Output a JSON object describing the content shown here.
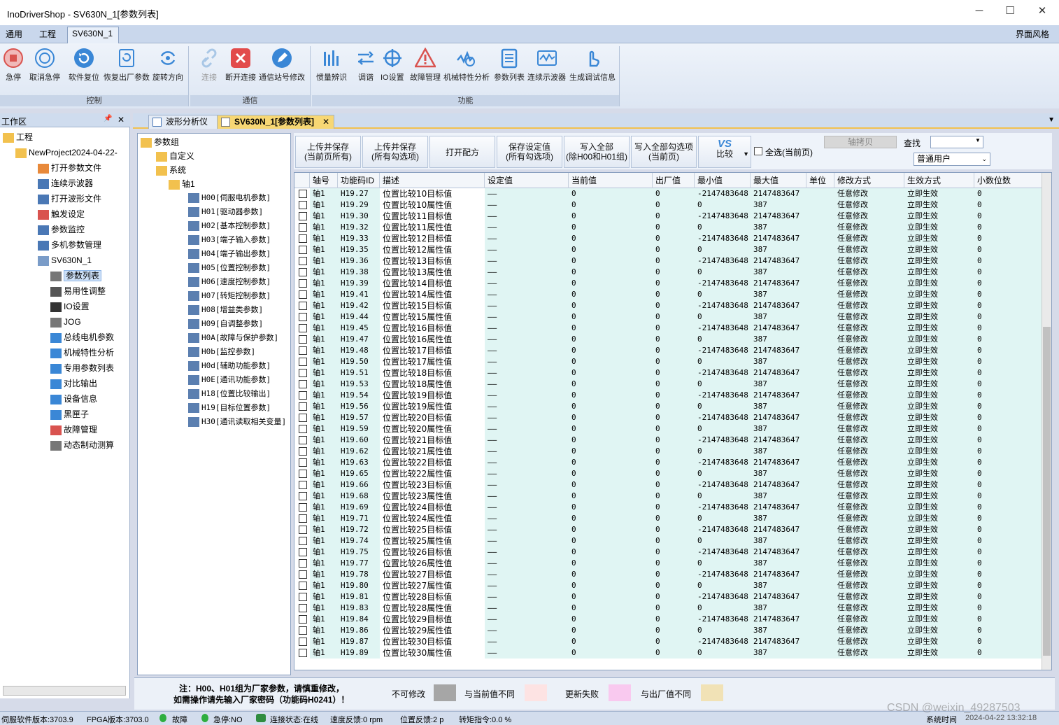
{
  "window": {
    "title": "InoDriverShop - SV630N_1[参数列表]",
    "min": "─",
    "max": "☐",
    "close": "✕"
  },
  "menu": {
    "tabs": [
      "通用",
      "工程",
      "SV630N_1"
    ],
    "style_label": "界面风格"
  },
  "ribbon": {
    "groups": [
      {
        "label": "控制",
        "buttons": [
          "急停",
          "取消急停",
          "软件复位",
          "恢复出厂参数",
          "旋转方向"
        ]
      },
      {
        "label": "通信",
        "buttons": [
          "连接",
          "断开连接",
          "通信站号修改"
        ]
      },
      {
        "label": "功能",
        "buttons": [
          "惯量辨识",
          "调谐",
          "IO设置",
          "故障管理",
          "机械特性分析",
          "参数列表",
          "连续示波器",
          "生成调试信息"
        ]
      }
    ]
  },
  "workspace": {
    "title": "工作区",
    "pin": "📌",
    "close": "✕",
    "tree": [
      {
        "label": "工程",
        "level": 0
      },
      {
        "label": "NewProject2024-04-22-",
        "level": 1
      },
      {
        "label": "打开参数文件",
        "level": 2
      },
      {
        "label": "连续示波器",
        "level": 2
      },
      {
        "label": "打开波形文件",
        "level": 2
      },
      {
        "label": "触发设定",
        "level": 2
      },
      {
        "label": "参数监控",
        "level": 2
      },
      {
        "label": "多机参数管理",
        "level": 2
      },
      {
        "label": "SV630N_1",
        "level": 2
      },
      {
        "label": "参数列表",
        "level": 3
      },
      {
        "label": "易用性调整",
        "level": 3
      },
      {
        "label": "IO设置",
        "level": 3
      },
      {
        "label": "JOG",
        "level": 3
      },
      {
        "label": "总线电机参数",
        "level": 3
      },
      {
        "label": "机械特性分析",
        "level": 3
      },
      {
        "label": "专用参数列表",
        "level": 3
      },
      {
        "label": "对比输出",
        "level": 3
      },
      {
        "label": "设备信息",
        "level": 3
      },
      {
        "label": "黑匣子",
        "level": 3
      },
      {
        "label": "故障管理",
        "level": 3
      },
      {
        "label": "动态制动测算",
        "level": 3
      }
    ]
  },
  "doc_tabs": [
    {
      "label": "波形分析仪"
    },
    {
      "label": "SV630N_1[参数列表]",
      "close": "✕"
    }
  ],
  "param_tree": {
    "root": "参数组",
    "nodes": [
      {
        "label": "自定义",
        "level": 1
      },
      {
        "label": "系统",
        "level": 1
      },
      {
        "label": "轴1",
        "level": 2
      },
      {
        "label": "H00[伺服电机参数]",
        "level": 3
      },
      {
        "label": "H01[驱动器参数]",
        "level": 3
      },
      {
        "label": "H02[基本控制参数]",
        "level": 3
      },
      {
        "label": "H03[端子输入参数]",
        "level": 3
      },
      {
        "label": "H04[端子输出参数]",
        "level": 3
      },
      {
        "label": "H05[位置控制参数]",
        "level": 3
      },
      {
        "label": "H06[速度控制参数]",
        "level": 3
      },
      {
        "label": "H07[转矩控制参数]",
        "level": 3
      },
      {
        "label": "H08[增益类参数]",
        "level": 3
      },
      {
        "label": "H09[自调整参数]",
        "level": 3
      },
      {
        "label": "H0A[故障与保护参数]",
        "level": 3
      },
      {
        "label": "H0b[监控参数]",
        "level": 3
      },
      {
        "label": "H0d[辅助功能参数]",
        "level": 3
      },
      {
        "label": "H0E[通讯功能参数]",
        "level": 3
      },
      {
        "label": "H18[位置比较输出]",
        "level": 3
      },
      {
        "label": "H19[目标位置参数]",
        "level": 3
      },
      {
        "label": "H30[通讯读取相关变量]",
        "level": 3
      }
    ]
  },
  "toolbar": {
    "buttons": [
      {
        "l1": "上传并保存",
        "l2": "(当前页所有)"
      },
      {
        "l1": "上传并保存",
        "l2": "(所有勾选项)"
      },
      {
        "l1": "打开配方",
        "l2": ""
      },
      {
        "l1": "保存设定值",
        "l2": "(所有勾选项)"
      },
      {
        "l1": "写入全部",
        "l2": "(除H00和H01组)"
      },
      {
        "l1": "写入全部勾选项",
        "l2": "(当前页)"
      }
    ],
    "compare_icon": "VS",
    "compare": "比较",
    "select_all": "全选(当前页)",
    "axis_copy": "轴拷贝",
    "search_label": "查找",
    "search_value": "",
    "user_mode": "普通用户"
  },
  "grid": {
    "columns": [
      "轴号",
      "功能码ID",
      "描述",
      "设定值",
      "当前值",
      "出厂值",
      "最小值",
      "最大值",
      "单位",
      "修改方式",
      "生效方式",
      "小数位数"
    ],
    "rows": [
      [
        "轴1",
        "H19.27",
        "位置比较10目标值",
        "——",
        "0",
        "0",
        "-2147483648",
        "2147483647",
        "",
        "任意修改",
        "立即生效",
        "0"
      ],
      [
        "轴1",
        "H19.29",
        "位置比较10属性值",
        "——",
        "0",
        "0",
        "0",
        "387",
        "",
        "任意修改",
        "立即生效",
        "0"
      ],
      [
        "轴1",
        "H19.30",
        "位置比较11目标值",
        "——",
        "0",
        "0",
        "-2147483648",
        "2147483647",
        "",
        "任意修改",
        "立即生效",
        "0"
      ],
      [
        "轴1",
        "H19.32",
        "位置比较11属性值",
        "——",
        "0",
        "0",
        "0",
        "387",
        "",
        "任意修改",
        "立即生效",
        "0"
      ],
      [
        "轴1",
        "H19.33",
        "位置比较12目标值",
        "——",
        "0",
        "0",
        "-2147483648",
        "2147483647",
        "",
        "任意修改",
        "立即生效",
        "0"
      ],
      [
        "轴1",
        "H19.35",
        "位置比较12属性值",
        "——",
        "0",
        "0",
        "0",
        "387",
        "",
        "任意修改",
        "立即生效",
        "0"
      ],
      [
        "轴1",
        "H19.36",
        "位置比较13目标值",
        "——",
        "0",
        "0",
        "-2147483648",
        "2147483647",
        "",
        "任意修改",
        "立即生效",
        "0"
      ],
      [
        "轴1",
        "H19.38",
        "位置比较13属性值",
        "——",
        "0",
        "0",
        "0",
        "387",
        "",
        "任意修改",
        "立即生效",
        "0"
      ],
      [
        "轴1",
        "H19.39",
        "位置比较14目标值",
        "——",
        "0",
        "0",
        "-2147483648",
        "2147483647",
        "",
        "任意修改",
        "立即生效",
        "0"
      ],
      [
        "轴1",
        "H19.41",
        "位置比较14属性值",
        "——",
        "0",
        "0",
        "0",
        "387",
        "",
        "任意修改",
        "立即生效",
        "0"
      ],
      [
        "轴1",
        "H19.42",
        "位置比较15目标值",
        "——",
        "0",
        "0",
        "-2147483648",
        "2147483647",
        "",
        "任意修改",
        "立即生效",
        "0"
      ],
      [
        "轴1",
        "H19.44",
        "位置比较15属性值",
        "——",
        "0",
        "0",
        "0",
        "387",
        "",
        "任意修改",
        "立即生效",
        "0"
      ],
      [
        "轴1",
        "H19.45",
        "位置比较16目标值",
        "——",
        "0",
        "0",
        "-2147483648",
        "2147483647",
        "",
        "任意修改",
        "立即生效",
        "0"
      ],
      [
        "轴1",
        "H19.47",
        "位置比较16属性值",
        "——",
        "0",
        "0",
        "0",
        "387",
        "",
        "任意修改",
        "立即生效",
        "0"
      ],
      [
        "轴1",
        "H19.48",
        "位置比较17目标值",
        "——",
        "0",
        "0",
        "-2147483648",
        "2147483647",
        "",
        "任意修改",
        "立即生效",
        "0"
      ],
      [
        "轴1",
        "H19.50",
        "位置比较17属性值",
        "——",
        "0",
        "0",
        "0",
        "387",
        "",
        "任意修改",
        "立即生效",
        "0"
      ],
      [
        "轴1",
        "H19.51",
        "位置比较18目标值",
        "——",
        "0",
        "0",
        "-2147483648",
        "2147483647",
        "",
        "任意修改",
        "立即生效",
        "0"
      ],
      [
        "轴1",
        "H19.53",
        "位置比较18属性值",
        "——",
        "0",
        "0",
        "0",
        "387",
        "",
        "任意修改",
        "立即生效",
        "0"
      ],
      [
        "轴1",
        "H19.54",
        "位置比较19目标值",
        "——",
        "0",
        "0",
        "-2147483648",
        "2147483647",
        "",
        "任意修改",
        "立即生效",
        "0"
      ],
      [
        "轴1",
        "H19.56",
        "位置比较19属性值",
        "——",
        "0",
        "0",
        "0",
        "387",
        "",
        "任意修改",
        "立即生效",
        "0"
      ],
      [
        "轴1",
        "H19.57",
        "位置比较20目标值",
        "——",
        "0",
        "0",
        "-2147483648",
        "2147483647",
        "",
        "任意修改",
        "立即生效",
        "0"
      ],
      [
        "轴1",
        "H19.59",
        "位置比较20属性值",
        "——",
        "0",
        "0",
        "0",
        "387",
        "",
        "任意修改",
        "立即生效",
        "0"
      ],
      [
        "轴1",
        "H19.60",
        "位置比较21目标值",
        "——",
        "0",
        "0",
        "-2147483648",
        "2147483647",
        "",
        "任意修改",
        "立即生效",
        "0"
      ],
      [
        "轴1",
        "H19.62",
        "位置比较21属性值",
        "——",
        "0",
        "0",
        "0",
        "387",
        "",
        "任意修改",
        "立即生效",
        "0"
      ],
      [
        "轴1",
        "H19.63",
        "位置比较22目标值",
        "——",
        "0",
        "0",
        "-2147483648",
        "2147483647",
        "",
        "任意修改",
        "立即生效",
        "0"
      ],
      [
        "轴1",
        "H19.65",
        "位置比较22属性值",
        "——",
        "0",
        "0",
        "0",
        "387",
        "",
        "任意修改",
        "立即生效",
        "0"
      ],
      [
        "轴1",
        "H19.66",
        "位置比较23目标值",
        "——",
        "0",
        "0",
        "-2147483648",
        "2147483647",
        "",
        "任意修改",
        "立即生效",
        "0"
      ],
      [
        "轴1",
        "H19.68",
        "位置比较23属性值",
        "——",
        "0",
        "0",
        "0",
        "387",
        "",
        "任意修改",
        "立即生效",
        "0"
      ],
      [
        "轴1",
        "H19.69",
        "位置比较24目标值",
        "——",
        "0",
        "0",
        "-2147483648",
        "2147483647",
        "",
        "任意修改",
        "立即生效",
        "0"
      ],
      [
        "轴1",
        "H19.71",
        "位置比较24属性值",
        "——",
        "0",
        "0",
        "0",
        "387",
        "",
        "任意修改",
        "立即生效",
        "0"
      ],
      [
        "轴1",
        "H19.72",
        "位置比较25目标值",
        "——",
        "0",
        "0",
        "-2147483648",
        "2147483647",
        "",
        "任意修改",
        "立即生效",
        "0"
      ],
      [
        "轴1",
        "H19.74",
        "位置比较25属性值",
        "——",
        "0",
        "0",
        "0",
        "387",
        "",
        "任意修改",
        "立即生效",
        "0"
      ],
      [
        "轴1",
        "H19.75",
        "位置比较26目标值",
        "——",
        "0",
        "0",
        "-2147483648",
        "2147483647",
        "",
        "任意修改",
        "立即生效",
        "0"
      ],
      [
        "轴1",
        "H19.77",
        "位置比较26属性值",
        "——",
        "0",
        "0",
        "0",
        "387",
        "",
        "任意修改",
        "立即生效",
        "0"
      ],
      [
        "轴1",
        "H19.78",
        "位置比较27目标值",
        "——",
        "0",
        "0",
        "-2147483648",
        "2147483647",
        "",
        "任意修改",
        "立即生效",
        "0"
      ],
      [
        "轴1",
        "H19.80",
        "位置比较27属性值",
        "——",
        "0",
        "0",
        "0",
        "387",
        "",
        "任意修改",
        "立即生效",
        "0"
      ],
      [
        "轴1",
        "H19.81",
        "位置比较28目标值",
        "——",
        "0",
        "0",
        "-2147483648",
        "2147483647",
        "",
        "任意修改",
        "立即生效",
        "0"
      ],
      [
        "轴1",
        "H19.83",
        "位置比较28属性值",
        "——",
        "0",
        "0",
        "0",
        "387",
        "",
        "任意修改",
        "立即生效",
        "0"
      ],
      [
        "轴1",
        "H19.84",
        "位置比较29目标值",
        "——",
        "0",
        "0",
        "-2147483648",
        "2147483647",
        "",
        "任意修改",
        "立即生效",
        "0"
      ],
      [
        "轴1",
        "H19.86",
        "位置比较29属性值",
        "——",
        "0",
        "0",
        "0",
        "387",
        "",
        "任意修改",
        "立即生效",
        "0"
      ],
      [
        "轴1",
        "H19.87",
        "位置比较30目标值",
        "——",
        "0",
        "0",
        "-2147483648",
        "2147483647",
        "",
        "任意修改",
        "立即生效",
        "0"
      ],
      [
        "轴1",
        "H19.89",
        "位置比较30属性值",
        "——",
        "0",
        "0",
        "0",
        "387",
        "",
        "任意修改",
        "立即生效",
        "0"
      ]
    ]
  },
  "legend": {
    "note1": "注：H00、H01组为厂家参数，请慎重修改，",
    "note2": "如需操作请先输入厂家密码（功能码H0241）！",
    "items": [
      {
        "label": "不可修改",
        "color": "#a6a6a6"
      },
      {
        "label": "与当前值不同",
        "color": "#fde3e3"
      },
      {
        "label": "更新失败",
        "color": "#f9c9ef"
      },
      {
        "label": "与出厂值不同",
        "color": "#f1e2b6"
      }
    ]
  },
  "status": {
    "items": [
      "伺服软件版本:3703.9",
      "FPGA版本:3703.0",
      "故障",
      "急停:NO",
      "连接状态:在线",
      "速度反馈:0 rpm",
      "位置反馈:2 p",
      "转矩指令:0.0 %"
    ],
    "time_label": "系统时间",
    "time": "2024-04-22 13:32:18",
    "watermark": "CSDN @weixin_49287503"
  },
  "colors": {
    "accent": "#3a87d6",
    "tint_row": "#e0f5f3",
    "tab_active": "#f7d774"
  }
}
